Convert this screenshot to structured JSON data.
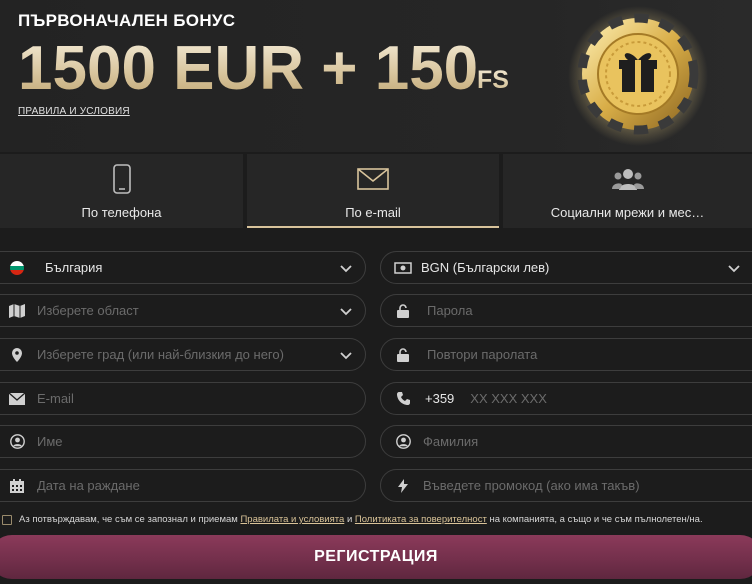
{
  "banner": {
    "subtitle": "ПЪРВОНАЧАЛЕН БОНУС",
    "amount": "1500 EUR + 150",
    "fs": "FS",
    "terms_link": "ПРАВИЛА И УСЛОВИЯ"
  },
  "tabs": [
    {
      "label": "По телефона",
      "icon": "phone-icon",
      "active": false
    },
    {
      "label": "По e-mail",
      "icon": "envelope-icon",
      "active": true
    },
    {
      "label": "Социални мрежи и мес…",
      "icon": "users-icon",
      "active": false
    }
  ],
  "form": {
    "country": "България",
    "currency": "BGN (Български лев)",
    "region_placeholder": "Изберете област",
    "password_placeholder": "Парола",
    "city_placeholder": "Изберете град (или най-близкия до него)",
    "repeat_password_placeholder": "Повтори паролата",
    "email_placeholder": "E-mail",
    "phone_prefix": "+359",
    "phone_placeholder": "XX XXX XXX",
    "first_name_placeholder": "Име",
    "last_name_placeholder": "Фамилия",
    "birthdate_placeholder": "Дата на раждане",
    "promo_placeholder": "Въведете промокод (ако има такъв)"
  },
  "consent": {
    "text_before": "Аз потвърждавам, че съм се запознал и приемам",
    "terms_link": "Правилата и условията",
    "and": "и",
    "privacy_link": "Политиката за поверителност",
    "text_after": "на компанията, а също и че съм пълнолетен/на."
  },
  "register_label": "РЕГИСТРАЦИЯ",
  "colors": {
    "accent_gold": "#d8c39b",
    "button": "#7a3352",
    "background": "#1c1c1c"
  }
}
